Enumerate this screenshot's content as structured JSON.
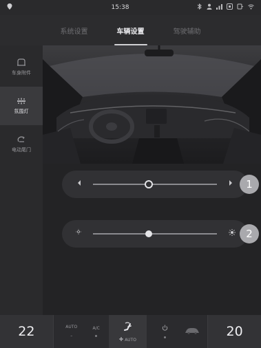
{
  "status_bar": {
    "time": "15:38"
  },
  "tabs": [
    {
      "label": "系统设置",
      "active": false
    },
    {
      "label": "车辆设置",
      "active": true
    },
    {
      "label": "驾驶辅助",
      "active": false
    }
  ],
  "sidebar": {
    "items": [
      {
        "label": "车身附件",
        "icon": "car-body-icon",
        "active": false
      },
      {
        "label": "氛围灯",
        "icon": "ambient-light-icon",
        "active": true
      },
      {
        "label": "电动尾门",
        "icon": "tailgate-icon",
        "active": false
      }
    ]
  },
  "controls": {
    "slider1": {
      "value": 0.45,
      "badge": "1",
      "left_icon": "arrow-left-icon",
      "right_icon": "arrow-right-icon"
    },
    "slider2": {
      "value": 0.45,
      "badge": "2",
      "left_icon": "brightness-low-icon",
      "right_icon": "brightness-high-icon"
    }
  },
  "climate": {
    "left_temp": "22",
    "right_temp": "20",
    "auto_label": "AUTO",
    "ac_label": "A/C",
    "fan_mode_label": "AUTO",
    "auto_indicator": "–"
  },
  "colors": {
    "accent": "#e4e4e7",
    "background": "#1f1f21",
    "panel": "#2c2c2e"
  }
}
